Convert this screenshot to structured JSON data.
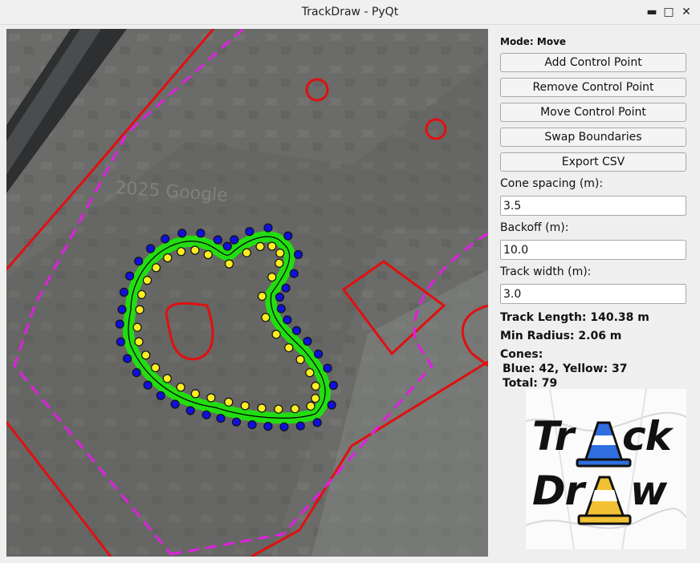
{
  "window": {
    "title": "TrackDraw - PyQt",
    "minimize_icon": "minimize-icon",
    "maximize_icon": "maximize-icon",
    "close_icon": "close-icon"
  },
  "panel": {
    "mode": "Mode: Move",
    "buttons": {
      "add": "Add Control Point",
      "remove": "Remove Control Point",
      "move": "Move Control Point",
      "swap": "Swap Boundaries",
      "export": "Export CSV"
    },
    "cone_spacing": {
      "label": "Cone spacing (m):",
      "value": "3.5"
    },
    "backoff": {
      "label": "Backoff (m):",
      "value": "10.0"
    },
    "track_width": {
      "label": "Track width (m):",
      "value": "3.0"
    },
    "track_length": "Track Length: 140.38 m",
    "min_radius": "Min Radius: 2.06 m",
    "cones_heading": "Cones:",
    "cones_counts": "Blue: 42, Yellow: 37",
    "cones_total": "Total: 79"
  },
  "map": {
    "watermark": "2025 Google",
    "colors": {
      "boundary": "#e01010",
      "offset": "#e020e0",
      "track": "#22dd11",
      "blue_cone": "#1010dd",
      "yellow_cone": "#ffee22",
      "centerline": "#000000"
    }
  },
  "logo": {
    "line1_a": "Tr",
    "line1_b": "ck",
    "line2_a": "Dr",
    "line2_b": "w",
    "blue_cone_color": "#2f6fe0",
    "yellow_cone_color": "#f2c234"
  }
}
